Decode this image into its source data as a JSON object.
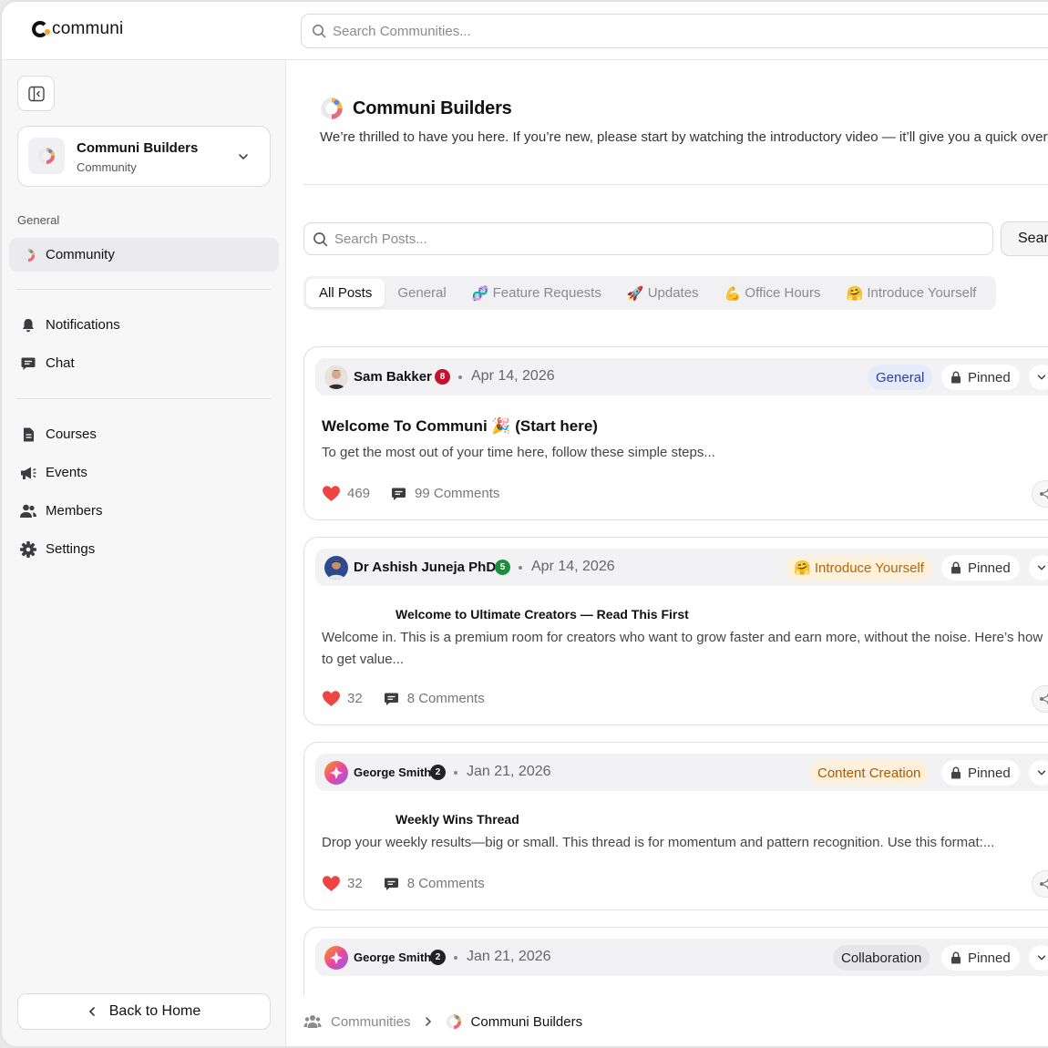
{
  "app": {
    "logo_text": "communi"
  },
  "topbar": {
    "search_placeholder": "Search Communities..."
  },
  "sidebar": {
    "community_name": "Communi Builders",
    "community_type": "Community",
    "section_label": "General",
    "items": [
      {
        "label": "Community",
        "icon": "community-logo-icon",
        "active": true
      },
      {
        "label": "Notifications",
        "icon": "bell-icon"
      },
      {
        "label": "Chat",
        "icon": "chat-icon"
      },
      {
        "label": "Courses",
        "icon": "document-icon"
      },
      {
        "label": "Events",
        "icon": "megaphone-icon"
      },
      {
        "label": "Members",
        "icon": "users-icon"
      },
      {
        "label": "Settings",
        "icon": "gear-icon"
      }
    ],
    "back_label": "Back to Home"
  },
  "header": {
    "title": "Communi Builders",
    "description": "We’re thrilled to have you here. If you’re new, please start by  watching the introductory video — it’ll give you a quick overview"
  },
  "posts_search": {
    "placeholder": "Search Posts...",
    "button_label": "Search"
  },
  "tabs": [
    {
      "label": "All Posts",
      "emoji": "",
      "active": true
    },
    {
      "label": "General",
      "emoji": ""
    },
    {
      "label": "Feature Requests",
      "emoji": "🧬"
    },
    {
      "label": "Updates",
      "emoji": "🚀"
    },
    {
      "label": "Office Hours",
      "emoji": "💪"
    },
    {
      "label": "Introduce Yourself",
      "emoji": "🤗"
    }
  ],
  "posts": [
    {
      "author": "Sam Bakker",
      "level": "8",
      "level_color": "#c8102e",
      "date": "Apr 14, 2026",
      "category": "General",
      "category_bg": "#e6ebfb",
      "category_color": "#2a3f9d",
      "pinned_label": "Pinned",
      "title": "Welcome To Communi 🎉 (Start here)",
      "excerpt": "To get the most out of your time here, follow these simple steps...",
      "likes": "469",
      "comments": "99 Comments"
    },
    {
      "author": "Dr Ashish Juneja PhD",
      "level": "5",
      "level_color": "#1e8e3e",
      "date": "Apr 14, 2026",
      "category": "🤗 Introduce Yourself",
      "category_bg": "#fdf1dc",
      "category_color": "#b5650b",
      "pinned_label": "Pinned",
      "title": "Welcome to Ultimate Creators — Read This First",
      "excerpt": "Welcome in. This is a premium room for creators who want to grow faster and earn more, without the noise. Here’s how to get value...",
      "likes": "32",
      "comments": "8 Comments"
    },
    {
      "author": "George Smith",
      "level": "2",
      "level_color": "#222",
      "date": "Jan 21, 2026",
      "category": "Content Creation",
      "category_bg": "#fdf0dd",
      "category_color": "#a85a08",
      "pinned_label": "Pinned",
      "title": "Weekly Wins Thread",
      "excerpt": "Drop your weekly results—big or small. This thread is for momentum and pattern recognition. Use this format:...",
      "likes": "32",
      "comments": "8 Comments"
    },
    {
      "author": "George Smith",
      "level": "2",
      "level_color": "#222",
      "date": "Jan 21, 2026",
      "category": "Collaboration",
      "category_bg": "#e6e6e8",
      "category_color": "#222",
      "pinned_label": "Pinned"
    }
  ],
  "breadcrumb": {
    "root": "Communities",
    "current": "Communi Builders"
  }
}
